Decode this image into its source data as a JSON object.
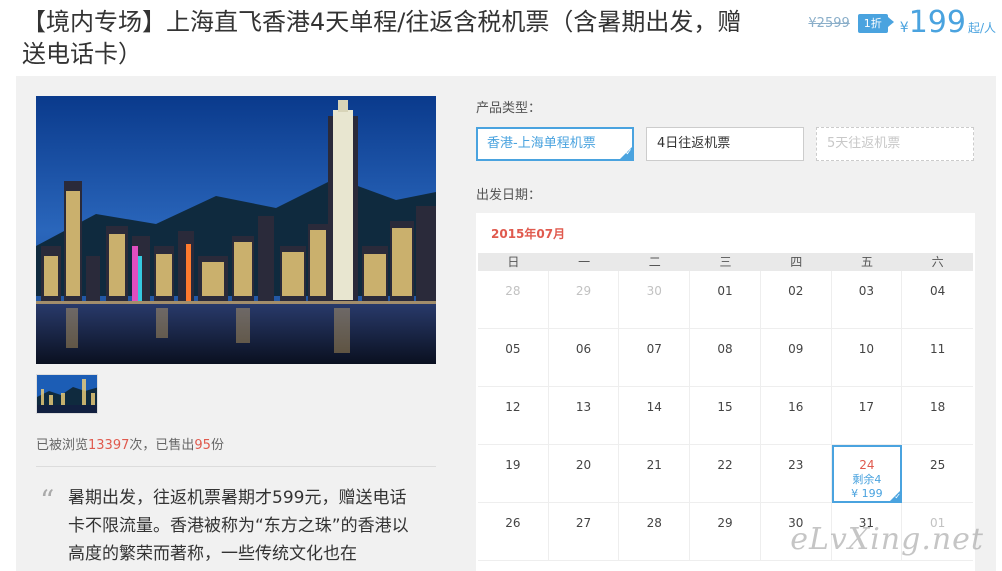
{
  "header": {
    "title": "【境内专场】上海直飞香港4天单程/往返含税机票（含暑期出发，赠送电话卡）",
    "original_price": "¥2599",
    "discount_badge": "1折",
    "price_currency": "¥",
    "price_value": "199",
    "price_unit": "起/人"
  },
  "gallery": {
    "main_image_alt": "香港夜景",
    "thumbnails": [
      "香港夜景缩略图"
    ]
  },
  "stats": {
    "prefix": "已被浏览",
    "views": "13397",
    "middle": "次，已售出",
    "sold": "95",
    "suffix": "份"
  },
  "description": "暑期出发，往返机票暑期才599元，赠送电话卡不限流量。香港被称为“东方之珠”的香港以高度的繁荣而著称，一些传统文化也在",
  "product_type": {
    "label": "产品类型：",
    "options": [
      {
        "label": "香港-上海单程机票",
        "state": "selected"
      },
      {
        "label": "4日往返机票",
        "state": "normal"
      },
      {
        "label": "5天往返机票",
        "state": "disabled"
      }
    ]
  },
  "departure": {
    "label": "出发日期：",
    "month": "2015年07月",
    "weekdays": [
      "日",
      "一",
      "二",
      "三",
      "四",
      "五",
      "六"
    ],
    "days": [
      {
        "d": "28",
        "muted": true
      },
      {
        "d": "29",
        "muted": true
      },
      {
        "d": "30",
        "muted": true
      },
      {
        "d": "01"
      },
      {
        "d": "02"
      },
      {
        "d": "03"
      },
      {
        "d": "04"
      },
      {
        "d": "05"
      },
      {
        "d": "06"
      },
      {
        "d": "07"
      },
      {
        "d": "08"
      },
      {
        "d": "09"
      },
      {
        "d": "10"
      },
      {
        "d": "11"
      },
      {
        "d": "12"
      },
      {
        "d": "13"
      },
      {
        "d": "14"
      },
      {
        "d": "15"
      },
      {
        "d": "16"
      },
      {
        "d": "17"
      },
      {
        "d": "18"
      },
      {
        "d": "19"
      },
      {
        "d": "20"
      },
      {
        "d": "21"
      },
      {
        "d": "22"
      },
      {
        "d": "23"
      },
      {
        "d": "24",
        "active": true,
        "remaining": "剩余4",
        "price": "¥ 199"
      },
      {
        "d": "25"
      },
      {
        "d": "26"
      },
      {
        "d": "27"
      },
      {
        "d": "28"
      },
      {
        "d": "29"
      },
      {
        "d": "30"
      },
      {
        "d": "31"
      },
      {
        "d": "01",
        "muted": true
      }
    ]
  },
  "watermark": "eLvXing.net",
  "colors": {
    "accent": "#4aa3df",
    "highlight": "#e05a4e",
    "panel": "#f1f1f1"
  }
}
